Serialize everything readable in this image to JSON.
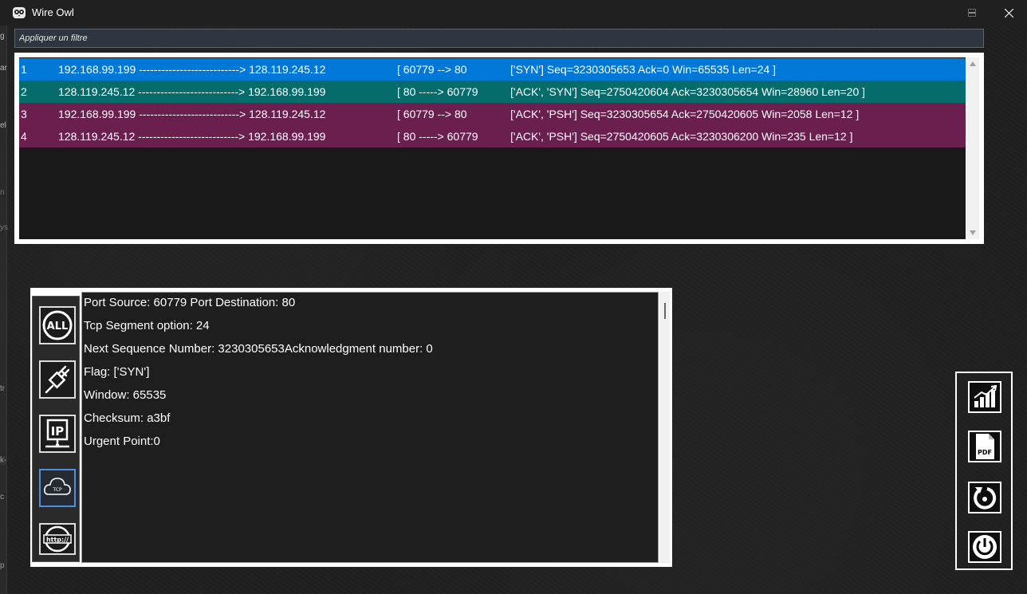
{
  "window": {
    "title": "Wire Owl",
    "controls": {
      "minimize": "minimize-icon",
      "maximize": "maximize-icon",
      "close": "close-icon"
    }
  },
  "filter": {
    "placeholder": "Appliquer un filtre",
    "value": ""
  },
  "packets": [
    {
      "no": "1",
      "route": "192.168.99.199 ---------------------------> 128.119.245.12",
      "ports": "[ 60779 --> 80",
      "info": "['SYN']  Seq=3230305653  Ack=0  Win=65535 Len=24 ]",
      "color": "#0078d7"
    },
    {
      "no": "2",
      "route": "128.119.245.12 ---------------------------> 192.168.99.199",
      "ports": "[ 80     -----> 60779",
      "info": "  ['ACK', 'SYN']  Seq=2750420604  Ack=3230305654  Win=28960 Len=20 ]",
      "color": "#066b6b"
    },
    {
      "no": "3",
      "route": "192.168.99.199 ---------------------------> 128.119.245.12",
      "ports": "[ 60779 --> 80",
      "info": "['ACK', 'PSH']  Seq=3230305654  Ack=2750420605  Win=2058 Len=12 ]",
      "color": "#6b1f4f"
    },
    {
      "no": "4",
      "route": "128.119.245.12 ---------------------------> 192.168.99.199",
      "ports": "[ 80     -----> 60779",
      "info": "  ['ACK', 'PSH']  Seq=2750420605  Ack=3230306200  Win=235 Len=12 ]",
      "color": "#6b1f4f"
    }
  ],
  "details": {
    "lines": [
      "Port Source: 60779 Port Destination: 80",
      "Tcp Segment option: 24",
      " Next Sequence Number: 3230305653Acknowledgment number: 0",
      "Flag: ['SYN']",
      " Window: 65535",
      "Checksum: a3bf",
      "Urgent Point:0"
    ]
  },
  "sidebar": {
    "buttons": [
      {
        "name": "all-filter-button",
        "icon": "all-icon",
        "label": "ALL"
      },
      {
        "name": "ethernet-filter-button",
        "icon": "ethernet-cable-icon"
      },
      {
        "name": "ip-filter-button",
        "icon": "ip-icon",
        "label": "IP"
      },
      {
        "name": "tcp-filter-button",
        "icon": "tcp-cloud-icon",
        "label": "TCP",
        "active": true
      },
      {
        "name": "http-filter-button",
        "icon": "http-globe-icon",
        "label": "http://"
      }
    ]
  },
  "tools": {
    "buttons": [
      {
        "name": "statistics-button",
        "icon": "bar-chart-icon"
      },
      {
        "name": "export-pdf-button",
        "icon": "pdf-file-icon",
        "label": "PDF"
      },
      {
        "name": "reload-button",
        "icon": "reload-icon"
      },
      {
        "name": "power-button",
        "icon": "power-icon"
      }
    ]
  },
  "background_edge": {
    "fragments": [
      "g",
      "ar",
      "el",
      "n",
      "ys",
      "tr",
      "k-",
      "c",
      "p"
    ]
  }
}
